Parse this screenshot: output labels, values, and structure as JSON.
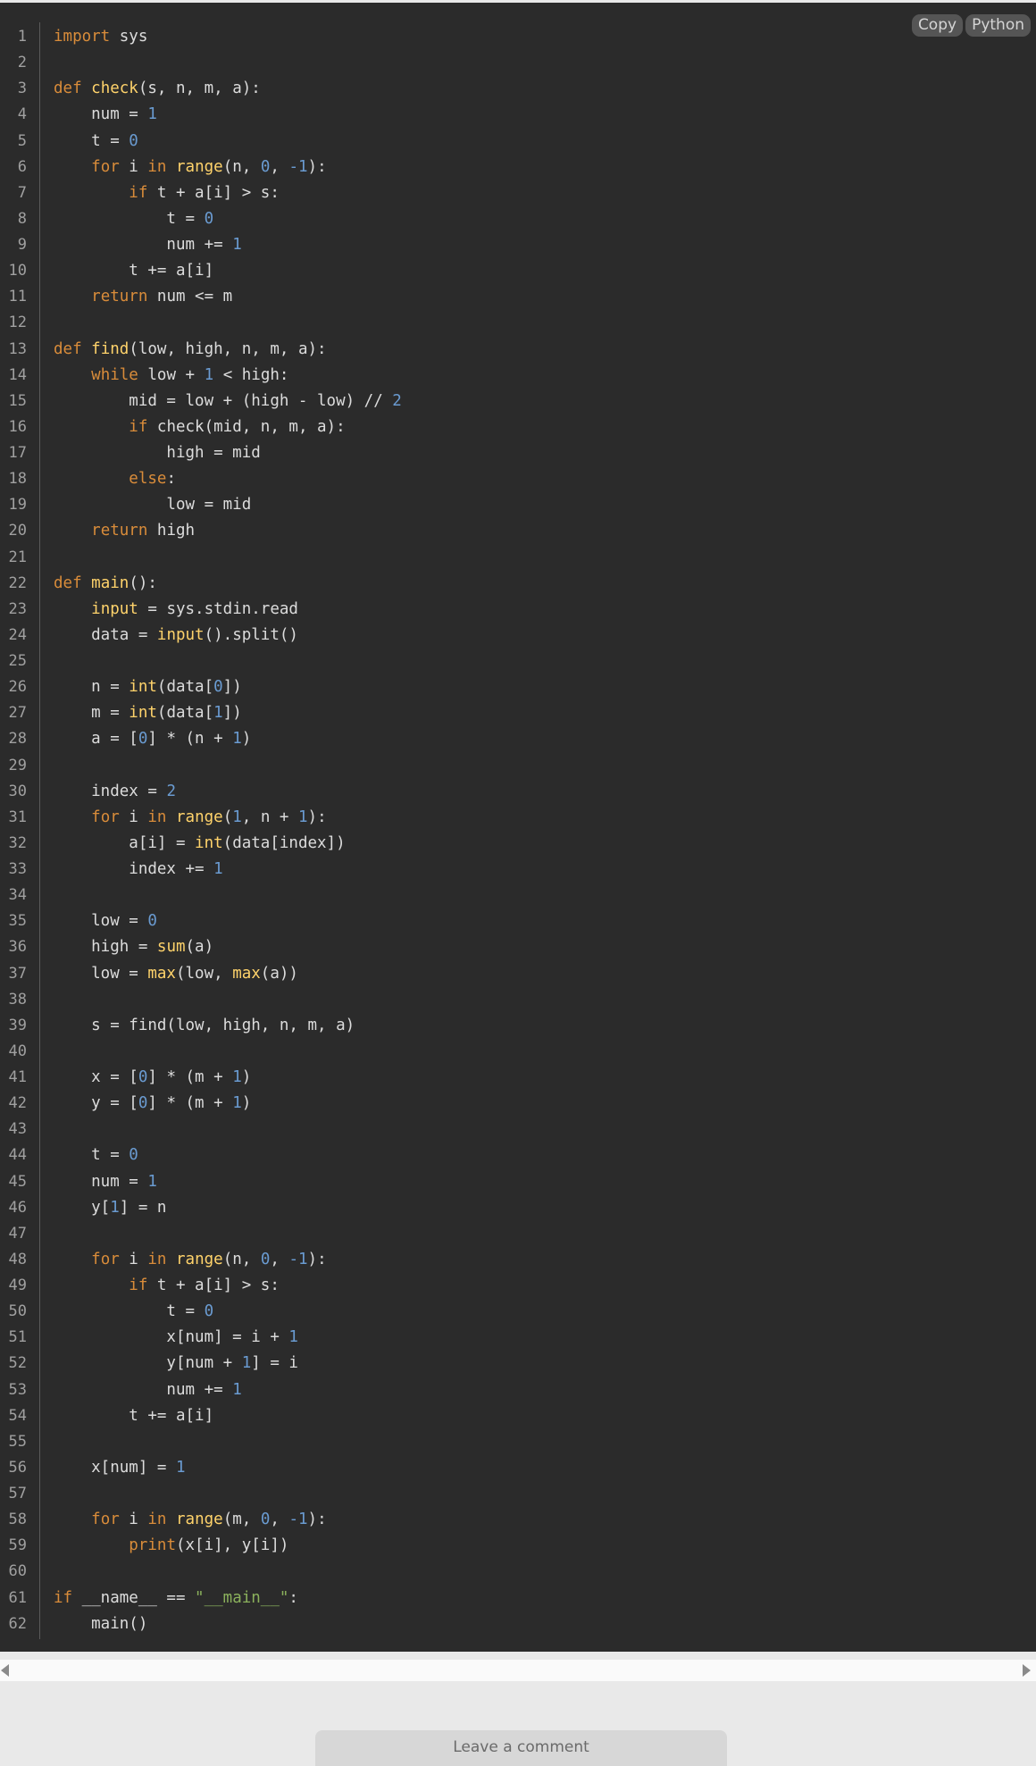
{
  "toolbar": {
    "copy_label": "Copy",
    "language_label": "Python"
  },
  "colors": {
    "background": "#2b2b2b",
    "keyword": "#d98c3a",
    "function_name": "#ffd36b",
    "number": "#6a9bd1",
    "string": "#8bb15c",
    "text": "#dcdcdc",
    "line_number": "#a0a0a0"
  },
  "code": {
    "language": "Python",
    "lines": [
      [
        [
          "kw",
          "import"
        ],
        [
          "t",
          " sys"
        ]
      ],
      [],
      [
        [
          "kw",
          "def"
        ],
        [
          "t",
          " "
        ],
        [
          "fn",
          "check"
        ],
        [
          "t",
          "(s, n, m, a):"
        ]
      ],
      [
        [
          "t",
          "    num = "
        ],
        [
          "num",
          "1"
        ]
      ],
      [
        [
          "t",
          "    t = "
        ],
        [
          "num",
          "0"
        ]
      ],
      [
        [
          "t",
          "    "
        ],
        [
          "kw",
          "for"
        ],
        [
          "t",
          " i "
        ],
        [
          "kw",
          "in"
        ],
        [
          "t",
          " "
        ],
        [
          "fn",
          "range"
        ],
        [
          "t",
          "(n, "
        ],
        [
          "num",
          "0"
        ],
        [
          "t",
          ", "
        ],
        [
          "num",
          "-1"
        ],
        [
          "t",
          "):"
        ]
      ],
      [
        [
          "t",
          "        "
        ],
        [
          "kw",
          "if"
        ],
        [
          "t",
          " t + a[i] > s:"
        ]
      ],
      [
        [
          "t",
          "            t = "
        ],
        [
          "num",
          "0"
        ]
      ],
      [
        [
          "t",
          "            num += "
        ],
        [
          "num",
          "1"
        ]
      ],
      [
        [
          "t",
          "        t += a[i]"
        ]
      ],
      [
        [
          "t",
          "    "
        ],
        [
          "kw",
          "return"
        ],
        [
          "t",
          " num <= m"
        ]
      ],
      [],
      [
        [
          "kw",
          "def"
        ],
        [
          "t",
          " "
        ],
        [
          "fn",
          "find"
        ],
        [
          "t",
          "(low, high, n, m, a):"
        ]
      ],
      [
        [
          "t",
          "    "
        ],
        [
          "kw",
          "while"
        ],
        [
          "t",
          " low + "
        ],
        [
          "num",
          "1"
        ],
        [
          "t",
          " < high:"
        ]
      ],
      [
        [
          "t",
          "        mid = low + (high - low) // "
        ],
        [
          "num",
          "2"
        ]
      ],
      [
        [
          "t",
          "        "
        ],
        [
          "kw",
          "if"
        ],
        [
          "t",
          " check(mid, n, m, a):"
        ]
      ],
      [
        [
          "t",
          "            high = mid"
        ]
      ],
      [
        [
          "t",
          "        "
        ],
        [
          "kw",
          "else"
        ],
        [
          "t",
          ":"
        ]
      ],
      [
        [
          "t",
          "            low = mid"
        ]
      ],
      [
        [
          "t",
          "    "
        ],
        [
          "kw",
          "return"
        ],
        [
          "t",
          " high"
        ]
      ],
      [],
      [
        [
          "kw",
          "def"
        ],
        [
          "t",
          " "
        ],
        [
          "fn",
          "main"
        ],
        [
          "t",
          "():"
        ]
      ],
      [
        [
          "t",
          "    "
        ],
        [
          "fn",
          "input"
        ],
        [
          "t",
          " = sys.stdin.read"
        ]
      ],
      [
        [
          "t",
          "    data = "
        ],
        [
          "fn",
          "input"
        ],
        [
          "t",
          "().split()"
        ]
      ],
      [],
      [
        [
          "t",
          "    n = "
        ],
        [
          "fn",
          "int"
        ],
        [
          "t",
          "(data["
        ],
        [
          "num",
          "0"
        ],
        [
          "t",
          "])"
        ]
      ],
      [
        [
          "t",
          "    m = "
        ],
        [
          "fn",
          "int"
        ],
        [
          "t",
          "(data["
        ],
        [
          "num",
          "1"
        ],
        [
          "t",
          "])"
        ]
      ],
      [
        [
          "t",
          "    a = ["
        ],
        [
          "num",
          "0"
        ],
        [
          "t",
          "] * (n + "
        ],
        [
          "num",
          "1"
        ],
        [
          "t",
          ")"
        ]
      ],
      [],
      [
        [
          "t",
          "    index = "
        ],
        [
          "num",
          "2"
        ]
      ],
      [
        [
          "t",
          "    "
        ],
        [
          "kw",
          "for"
        ],
        [
          "t",
          " i "
        ],
        [
          "kw",
          "in"
        ],
        [
          "t",
          " "
        ],
        [
          "fn",
          "range"
        ],
        [
          "t",
          "("
        ],
        [
          "num",
          "1"
        ],
        [
          "t",
          ", n + "
        ],
        [
          "num",
          "1"
        ],
        [
          "t",
          "):"
        ]
      ],
      [
        [
          "t",
          "        a[i] = "
        ],
        [
          "fn",
          "int"
        ],
        [
          "t",
          "(data[index])"
        ]
      ],
      [
        [
          "t",
          "        index += "
        ],
        [
          "num",
          "1"
        ]
      ],
      [],
      [
        [
          "t",
          "    low = "
        ],
        [
          "num",
          "0"
        ]
      ],
      [
        [
          "t",
          "    high = "
        ],
        [
          "fn",
          "sum"
        ],
        [
          "t",
          "(a)"
        ]
      ],
      [
        [
          "t",
          "    low = "
        ],
        [
          "fn",
          "max"
        ],
        [
          "t",
          "(low, "
        ],
        [
          "fn",
          "max"
        ],
        [
          "t",
          "(a))"
        ]
      ],
      [],
      [
        [
          "t",
          "    s = find(low, high, n, m, a)"
        ]
      ],
      [],
      [
        [
          "t",
          "    x = ["
        ],
        [
          "num",
          "0"
        ],
        [
          "t",
          "] * (m + "
        ],
        [
          "num",
          "1"
        ],
        [
          "t",
          ")"
        ]
      ],
      [
        [
          "t",
          "    y = ["
        ],
        [
          "num",
          "0"
        ],
        [
          "t",
          "] * (m + "
        ],
        [
          "num",
          "1"
        ],
        [
          "t",
          ")"
        ]
      ],
      [],
      [
        [
          "t",
          "    t = "
        ],
        [
          "num",
          "0"
        ]
      ],
      [
        [
          "t",
          "    num = "
        ],
        [
          "num",
          "1"
        ]
      ],
      [
        [
          "t",
          "    y["
        ],
        [
          "num",
          "1"
        ],
        [
          "t",
          "] = n"
        ]
      ],
      [],
      [
        [
          "t",
          "    "
        ],
        [
          "kw",
          "for"
        ],
        [
          "t",
          " i "
        ],
        [
          "kw",
          "in"
        ],
        [
          "t",
          " "
        ],
        [
          "fn",
          "range"
        ],
        [
          "t",
          "(n, "
        ],
        [
          "num",
          "0"
        ],
        [
          "t",
          ", "
        ],
        [
          "num",
          "-1"
        ],
        [
          "t",
          "):"
        ]
      ],
      [
        [
          "t",
          "        "
        ],
        [
          "kw",
          "if"
        ],
        [
          "t",
          " t + a[i] > s:"
        ]
      ],
      [
        [
          "t",
          "            t = "
        ],
        [
          "num",
          "0"
        ]
      ],
      [
        [
          "t",
          "            x[num] = i + "
        ],
        [
          "num",
          "1"
        ]
      ],
      [
        [
          "t",
          "            y[num + "
        ],
        [
          "num",
          "1"
        ],
        [
          "t",
          "] = i"
        ]
      ],
      [
        [
          "t",
          "            num += "
        ],
        [
          "num",
          "1"
        ]
      ],
      [
        [
          "t",
          "        t += a[i]"
        ]
      ],
      [],
      [
        [
          "t",
          "    x[num] = "
        ],
        [
          "num",
          "1"
        ]
      ],
      [],
      [
        [
          "t",
          "    "
        ],
        [
          "kw",
          "for"
        ],
        [
          "t",
          " i "
        ],
        [
          "kw",
          "in"
        ],
        [
          "t",
          " "
        ],
        [
          "fn",
          "range"
        ],
        [
          "t",
          "(m, "
        ],
        [
          "num",
          "0"
        ],
        [
          "t",
          ", "
        ],
        [
          "num",
          "-1"
        ],
        [
          "t",
          "):"
        ]
      ],
      [
        [
          "t",
          "        "
        ],
        [
          "kw",
          "print"
        ],
        [
          "t",
          "(x[i], y[i])"
        ]
      ],
      [],
      [
        [
          "kw",
          "if"
        ],
        [
          "t",
          " __name__ == "
        ],
        [
          "str",
          "\"__main__\""
        ],
        [
          "t",
          ":"
        ]
      ],
      [
        [
          "t",
          "    main()"
        ]
      ]
    ]
  },
  "comment": {
    "label": "Leave a comment"
  }
}
